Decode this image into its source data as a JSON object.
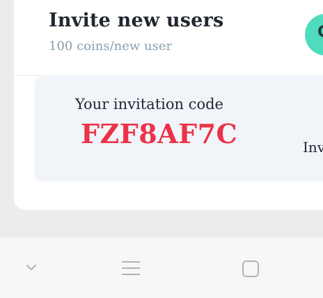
{
  "header": {
    "title": "Invite new users",
    "subtitle": "100 coins/new user",
    "action_button_label": "C"
  },
  "invite_panel": {
    "code_label": "Your invitation code",
    "code_value": "FZF8AF7C",
    "partial_label": "Inv"
  },
  "nav_bar": {
    "icons": [
      "chevron-down-icon",
      "menu-icon",
      "square-icon"
    ]
  },
  "colors": {
    "background": "#ececec",
    "card": "#ffffff",
    "panel": "#f1f5fa",
    "title": "#222831",
    "subtitle": "#8aa0b0",
    "code": "#ec3348",
    "accent": "#4fdcbe",
    "nav_icon": "#b3b3b3"
  }
}
